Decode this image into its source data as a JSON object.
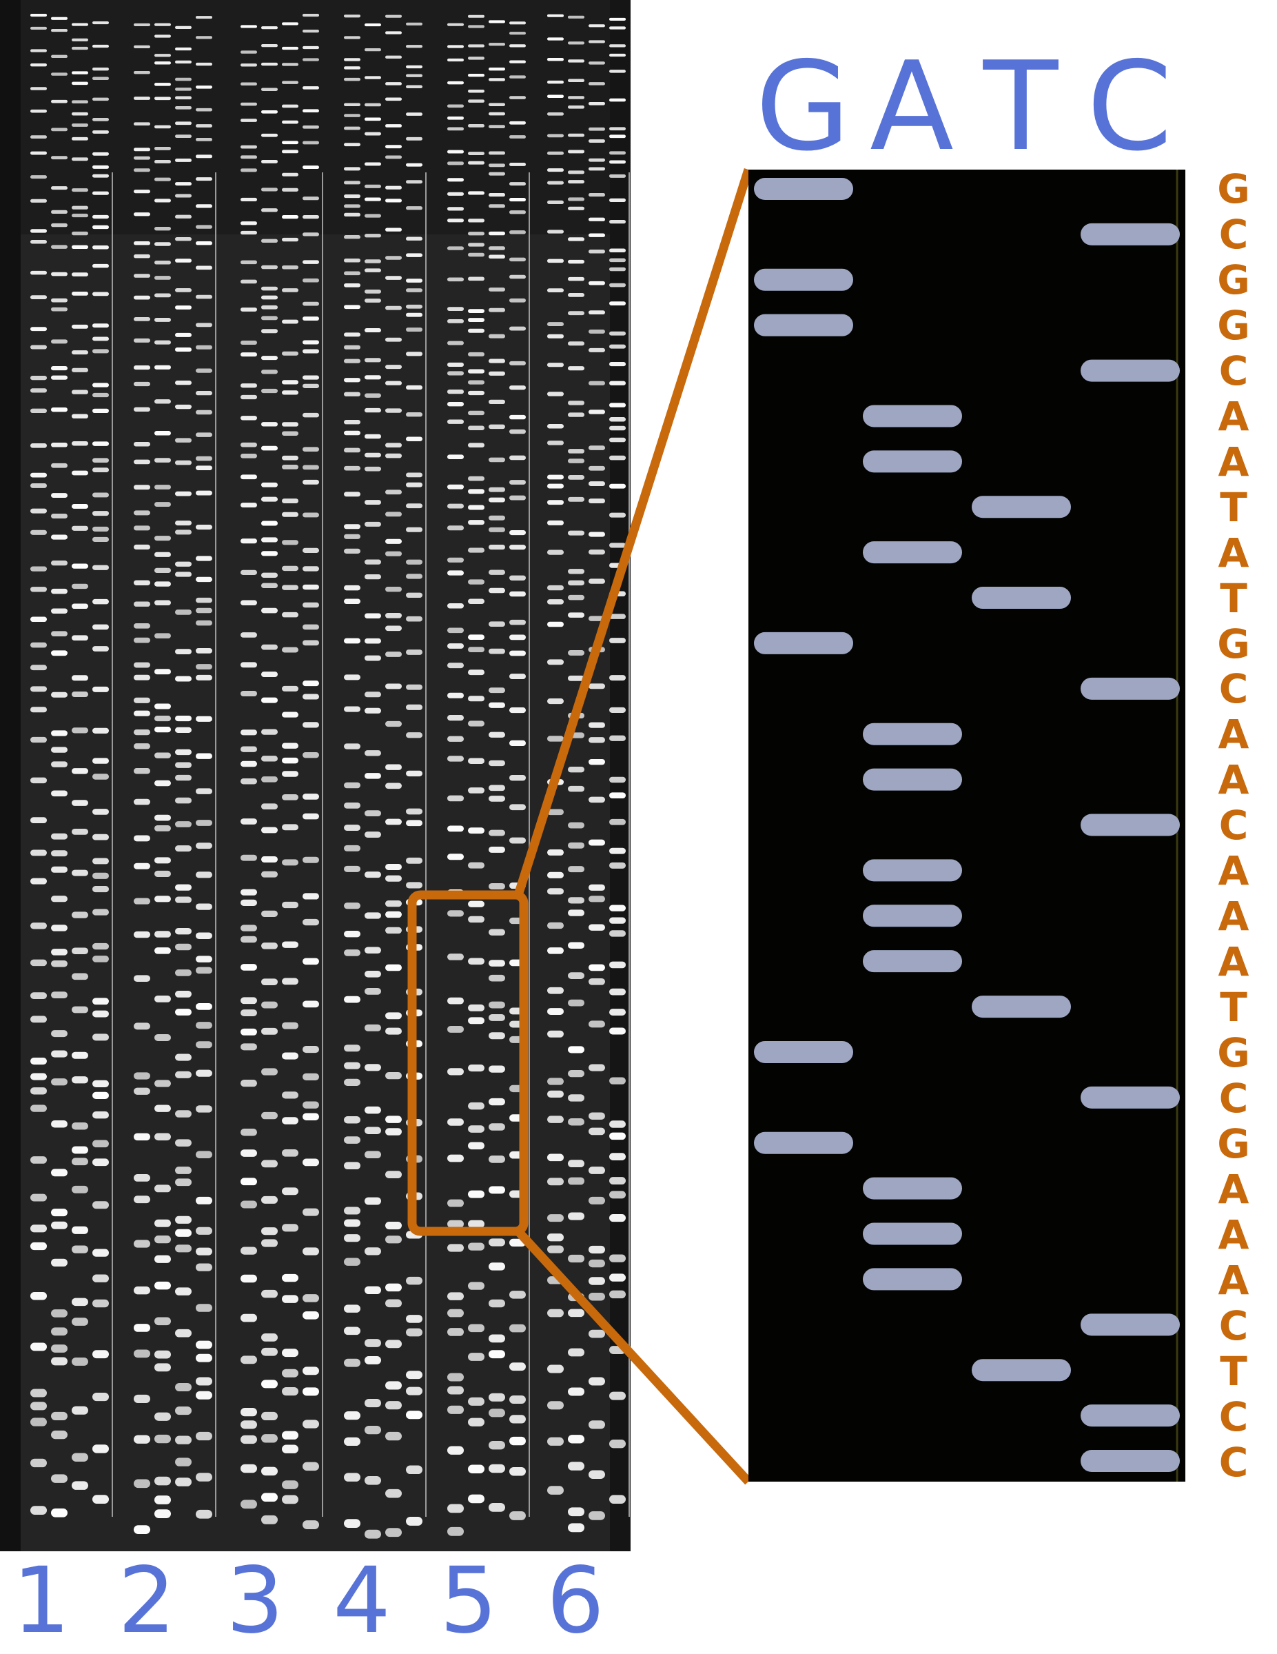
{
  "colors": {
    "lane_labels": "#5873d8",
    "column_headers": "#5873d8",
    "sequence": "#c8690c",
    "zoom_frame": "#c8690c",
    "gel_background": "#202020",
    "panel_background": "#030302",
    "panel_band": "#9ea6c2"
  },
  "gel": {
    "lane_labels": [
      "1",
      "2",
      "3",
      "4",
      "5",
      "6"
    ]
  },
  "zoom_panel": {
    "column_headers": [
      "G",
      "A",
      "T",
      "C"
    ],
    "sequence": [
      "G",
      "C",
      "G",
      "G",
      "C",
      "A",
      "A",
      "T",
      "A",
      "T",
      "G",
      "C",
      "A",
      "A",
      "C",
      "A",
      "A",
      "A",
      "T",
      "G",
      "C",
      "G",
      "A",
      "A",
      "A",
      "C",
      "T",
      "C",
      "C"
    ]
  }
}
